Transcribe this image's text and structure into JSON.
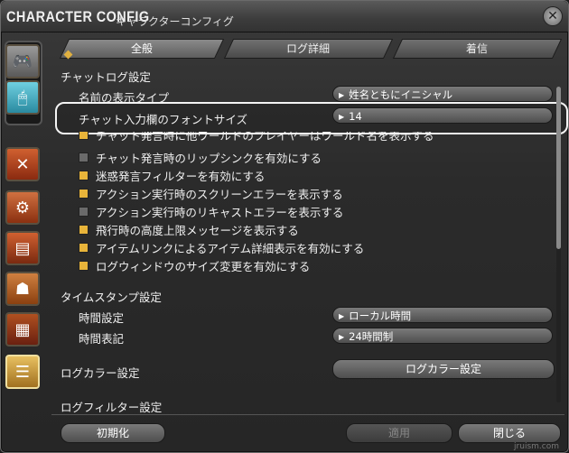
{
  "window": {
    "title_en": "CHARACTER CONFIG",
    "title_jp": "キャラクターコンフィグ",
    "close_symbol": "✕"
  },
  "tabs": [
    {
      "label": "全般",
      "active": true
    },
    {
      "label": "ログ詳細",
      "active": false
    },
    {
      "label": "着信",
      "active": false
    }
  ],
  "chat_log": {
    "heading": "チャットログ設定",
    "name_display_label": "名前の表示タイプ",
    "name_display_value": "姓名ともにイニシャル",
    "font_size_label": "チャット入力欄のフォントサイズ",
    "font_size_value": "14",
    "checkboxes": [
      {
        "label": "チャット発言時に他ワールドのプレイヤーはワールド名を表示する",
        "checked": true
      },
      {
        "label": "チャット発言時のリップシンクを有効にする",
        "checked": false
      },
      {
        "label": "迷惑発言フィルターを有効にする",
        "checked": true
      },
      {
        "label": "アクション実行時のスクリーンエラーを表示する",
        "checked": true
      },
      {
        "label": "アクション実行時のリキャストエラーを表示する",
        "checked": false
      },
      {
        "label": "飛行時の高度上限メッセージを表示する",
        "checked": true
      },
      {
        "label": "アイテムリンクによるアイテム詳細表示を有効にする",
        "checked": true
      },
      {
        "label": "ログウィンドウのサイズ変更を有効にする",
        "checked": true
      }
    ]
  },
  "timestamp": {
    "heading": "タイムスタンプ設定",
    "time_setting_label": "時間設定",
    "time_setting_value": "ローカル時間",
    "time_format_label": "時間表記",
    "time_format_value": "24時間制"
  },
  "log_color": {
    "heading": "ログカラー設定",
    "button": "ログカラー設定"
  },
  "log_filter": {
    "heading": "ログフィルター設定"
  },
  "footer": {
    "reset": "初期化",
    "apply": "適用",
    "close": "閉じる"
  },
  "watermark": "jruism.com",
  "colors": {
    "checked": "#e8b43a",
    "unchecked": "#6a6a6a",
    "highlight": "#f4f4f4"
  }
}
